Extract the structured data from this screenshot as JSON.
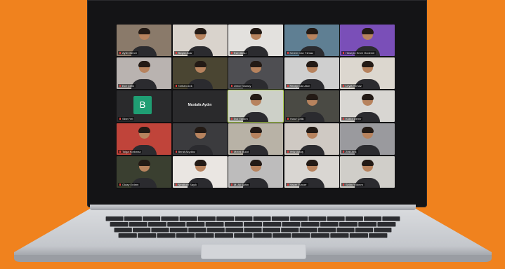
{
  "meeting": {
    "participants": [
      {
        "label": "Ayfer Bener",
        "bg": "#8a7a6a",
        "active": false
      },
      {
        "label": "Başak Acar",
        "bg": "#d9d3cc",
        "active": false
      },
      {
        "label": "Ezel Aksu",
        "bg": "#e3e1de",
        "active": false
      },
      {
        "label": "Kerem Can Yılmaz",
        "bg": "#5f7f93",
        "active": false
      },
      {
        "label": "Hüseyin Emre Özdemir",
        "bg": "#7a4fb8",
        "active": false
      },
      {
        "label": "Ece Çelik",
        "bg": "#b9b3b0",
        "active": false
      },
      {
        "label": "Tarhan Arık",
        "bg": "#4a4532",
        "active": false
      },
      {
        "label": "Umut Tolunay",
        "bg": "#4e4e52",
        "active": false
      },
      {
        "label": "Recep Can Akın",
        "bg": "#cfcfcf",
        "active": false
      },
      {
        "label": "Leylâ Yılmaz",
        "bg": "#dcd7cf",
        "active": false
      },
      {
        "label": "Sibel Yel",
        "bg": "#2a2a2c",
        "avatar_letter": "B",
        "active": false
      },
      {
        "label": "",
        "bg": "#2a2a2c",
        "big_label": "Mustafa Aydın",
        "active": false
      },
      {
        "label": "İnci Yardım",
        "bg": "#cdd0c8",
        "active": true
      },
      {
        "label": "Yusuf Çelik",
        "bg": "#4a4a44",
        "active": false
      },
      {
        "label": "Kübra Demir",
        "bg": "#d8d6d2",
        "active": false
      },
      {
        "label": "Tolga Korkmaz",
        "bg": "#c0443a",
        "active": false
      },
      {
        "label": "Berat Akyıldız",
        "bg": "#3b3b3e",
        "active": false
      },
      {
        "label": "Melek Bulut",
        "bg": "#b8b2a6",
        "active": false
      },
      {
        "label": "Yeliz Aktaş",
        "bg": "#cfc9c3",
        "active": false
      },
      {
        "label": "Zeki Arık",
        "bg": "#9a9a9e",
        "active": false
      },
      {
        "label": "Oktay Erdem",
        "bg": "#3a3f30",
        "active": false
      },
      {
        "label": "Neslihan Sayılı",
        "bg": "#eae6e2",
        "active": false
      },
      {
        "label": "M. Ali Şahin",
        "bg": "#bdbcbc",
        "active": false
      },
      {
        "label": "Hacer Tuncer",
        "bg": "#d9d6d2",
        "active": false
      },
      {
        "label": "Selim Yıldırım",
        "bg": "#d0cec9",
        "active": false
      }
    ]
  },
  "colors": {
    "background": "#f0821e",
    "laptop_bezel": "#141416",
    "active_speaker": "#b6d75a",
    "avatar": "#1f9e73"
  }
}
